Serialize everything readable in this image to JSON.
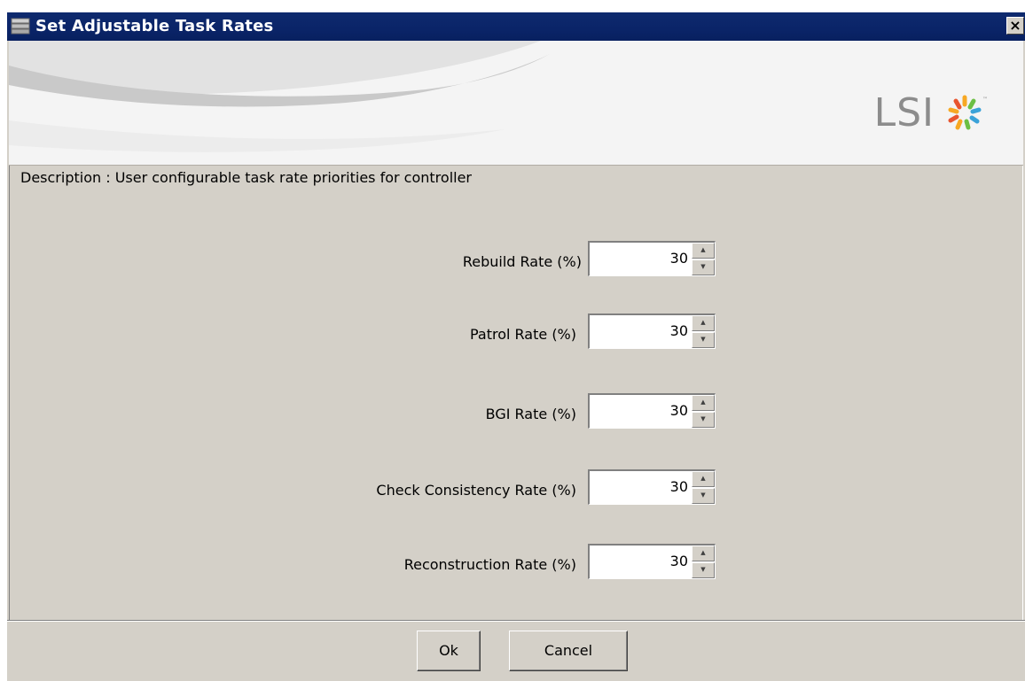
{
  "window": {
    "title": "Set Adjustable Task Rates",
    "close_label": "×"
  },
  "banner": {
    "logo_text": "LSI"
  },
  "description": "Description : User configurable task rate priorities for controller",
  "rates": [
    {
      "label": "Rebuild Rate (%)",
      "value": "30"
    },
    {
      "label": "Patrol Rate (%)",
      "value": "30"
    },
    {
      "label": "BGI Rate (%)",
      "value": "30"
    },
    {
      "label": "Check Consistency Rate (%)",
      "value": "30"
    },
    {
      "label": "Reconstruction Rate (%)",
      "value": "30"
    }
  ],
  "buttons": {
    "ok_label": "Ok",
    "cancel_label": "Cancel"
  },
  "colors": {
    "titlebar": "#0a2468",
    "dialog_bg": "#d4d0c8",
    "banner_bg": "#f4f4f4",
    "logo_text": "#8c8c8c"
  }
}
